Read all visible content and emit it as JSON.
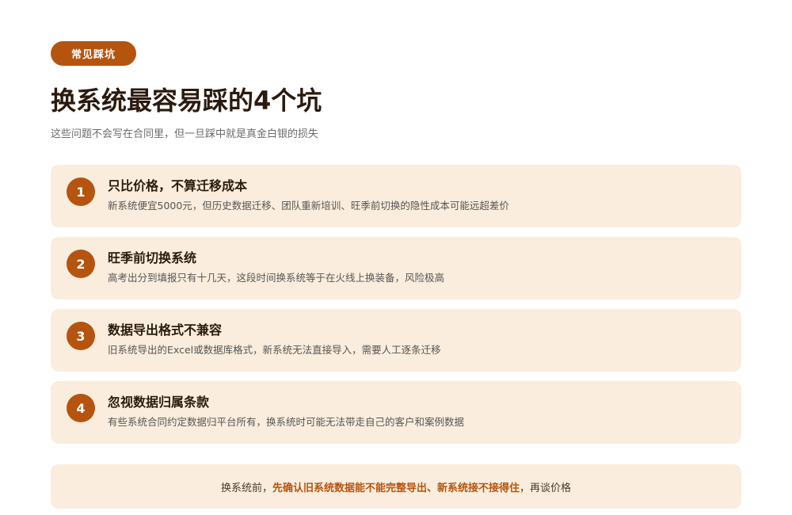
{
  "badge": "常见踩坑",
  "title": "换系统最容易踩的4个坑",
  "subtitle": "这些问题不会写在合同里，但一旦踩中就是真金白银的损失",
  "items": [
    {
      "num": "1",
      "title": "只比价格，不算迁移成本",
      "desc": "新系统便宜5000元，但历史数据迁移、团队重新培训、旺季前切换的隐性成本可能远超差价"
    },
    {
      "num": "2",
      "title": "旺季前切换系统",
      "desc": "高考出分到填报只有十几天，这段时间换系统等于在火线上换装备，风险极高"
    },
    {
      "num": "3",
      "title": "数据导出格式不兼容",
      "desc": "旧系统导出的Excel或数据库格式，新系统无法直接导入，需要人工逐条迁移"
    },
    {
      "num": "4",
      "title": "忽视数据归属条款",
      "desc": "有些系统合同约定数据归平台所有，换系统时可能无法带走自己的客户和案例数据"
    }
  ],
  "footer": {
    "prefix": "换系统前，",
    "highlight": "先确认旧系统数据能不能完整导出、新系统接不接得住",
    "suffix": "，再谈价格"
  },
  "colors": {
    "accent": "#b5540f",
    "card_bg": "#faeddd",
    "text": "#2b1a0e"
  }
}
